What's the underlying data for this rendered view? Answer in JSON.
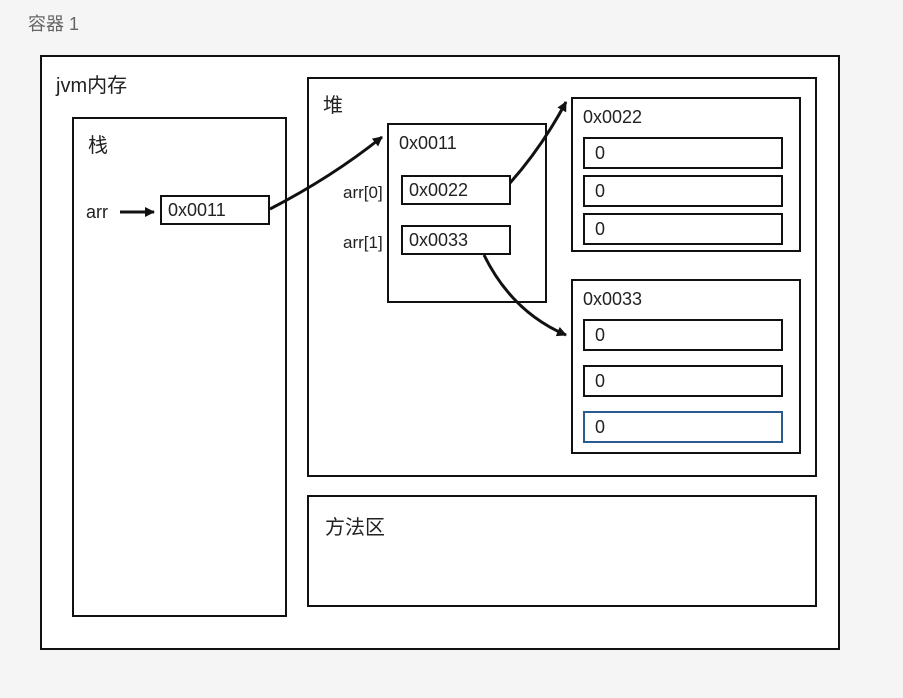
{
  "container_label": "容器 1",
  "jvm_title": "jvm内存",
  "stack": {
    "title": "栈",
    "var_name": "arr",
    "var_value": "0x0011"
  },
  "heap": {
    "title": "堆",
    "obj_0011": {
      "address": "0x0011",
      "fields": [
        {
          "label": "arr[0]",
          "value": "0x0022"
        },
        {
          "label": "arr[1]",
          "value": "0x0033"
        }
      ]
    },
    "obj_0022": {
      "address": "0x0022",
      "values": [
        "0",
        "0",
        "0"
      ]
    },
    "obj_0033": {
      "address": "0x0033",
      "values": [
        "0",
        "0",
        "0"
      ]
    }
  },
  "method_area": {
    "title": "方法区"
  },
  "colors": {
    "border": "#111111",
    "highlight": "#2a5a8f",
    "bg": "#f5f5f5"
  }
}
